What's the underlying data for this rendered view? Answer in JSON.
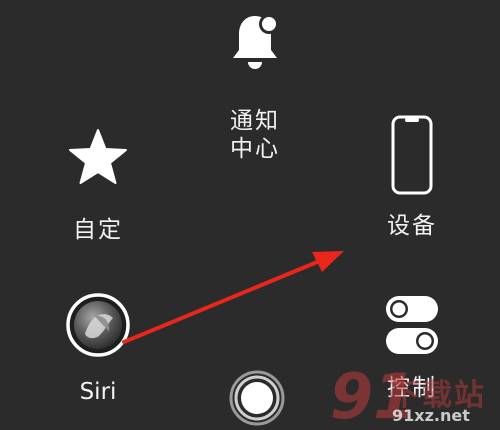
{
  "menu": {
    "notification_center": {
      "label": "通知中心",
      "icon": "bell-icon"
    },
    "custom": {
      "label": "自定",
      "icon": "star-icon"
    },
    "device": {
      "label": "设备",
      "icon": "phone-icon"
    },
    "siri": {
      "label": "Siri",
      "icon": "siri-icon"
    },
    "control_center": {
      "label": "控制",
      "icon": "toggle-icon"
    }
  },
  "home_button": {
    "icon": "home-button-icon"
  },
  "annotation": {
    "color": "#e8261c",
    "icon": "red-arrow"
  },
  "watermark": {
    "number": "91",
    "text": "下载站",
    "url": "91xz.net"
  },
  "colors": {
    "background": "#2b2b2b",
    "foreground": "#ffffff"
  }
}
